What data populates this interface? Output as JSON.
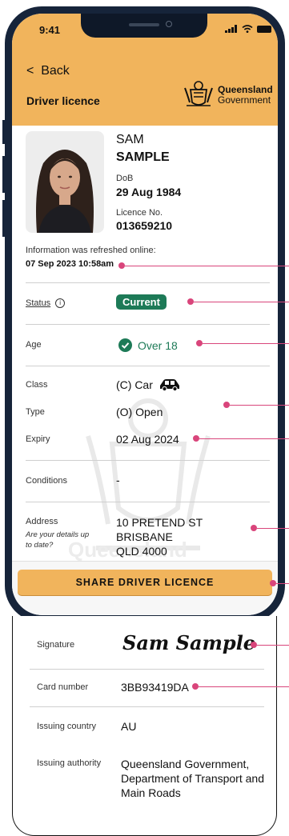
{
  "status_bar": {
    "time": "9:41"
  },
  "header": {
    "back_label": "Back",
    "title": "Driver licence",
    "logo_line1": "Queensland",
    "logo_line2": "Government"
  },
  "holder": {
    "first_name": "SAM",
    "last_name": "SAMPLE",
    "dob_label": "DoB",
    "dob": "29 Aug 1984",
    "licence_label": "Licence No.",
    "licence_no": "013659210"
  },
  "refresh": {
    "label": "Information was refreshed online:",
    "timestamp": "07 Sep 2023 10:58am"
  },
  "status": {
    "label": "Status",
    "info_glyph": "i",
    "value": "Current"
  },
  "age": {
    "label": "Age",
    "value": "Over 18"
  },
  "class": {
    "label": "Class",
    "value": "(C) Car"
  },
  "type": {
    "label": "Type",
    "value": "(O) Open"
  },
  "expiry": {
    "label": "Expiry",
    "value": "02 Aug 2024"
  },
  "conditions": {
    "label": "Conditions",
    "value": "-"
  },
  "address": {
    "label": "Address",
    "prompt_line1": "Are your details up",
    "prompt_line2": "to date?",
    "line1": "10 PRETEND ST",
    "line2": "BRISBANE",
    "line3": "QLD 4000"
  },
  "watermark": "Queensland",
  "share_button": "SHARE DRIVER LICENCE",
  "lower": {
    "signature_label": "Signature",
    "signature": "Sam Sample",
    "card_number_label": "Card number",
    "card_number": "3BB93419DA",
    "country_label": "Issuing country",
    "country": "AU",
    "authority_label": "Issuing authority",
    "authority_line1": "Queensland Government,",
    "authority_line2": "Department of Transport and",
    "authority_line3": "Main Roads"
  },
  "colors": {
    "header_bg": "#f1b45c",
    "status_badge": "#1d7a57",
    "callout": "#d9457b",
    "frame": "#16243a"
  },
  "icons": {
    "back": "chevron-left-icon",
    "signal": "signal-icon",
    "wifi": "wifi-icon",
    "battery": "battery-icon",
    "info": "info-icon",
    "check": "check-circle-icon",
    "car": "car-icon",
    "logo": "queensland-coat-of-arms-icon"
  }
}
